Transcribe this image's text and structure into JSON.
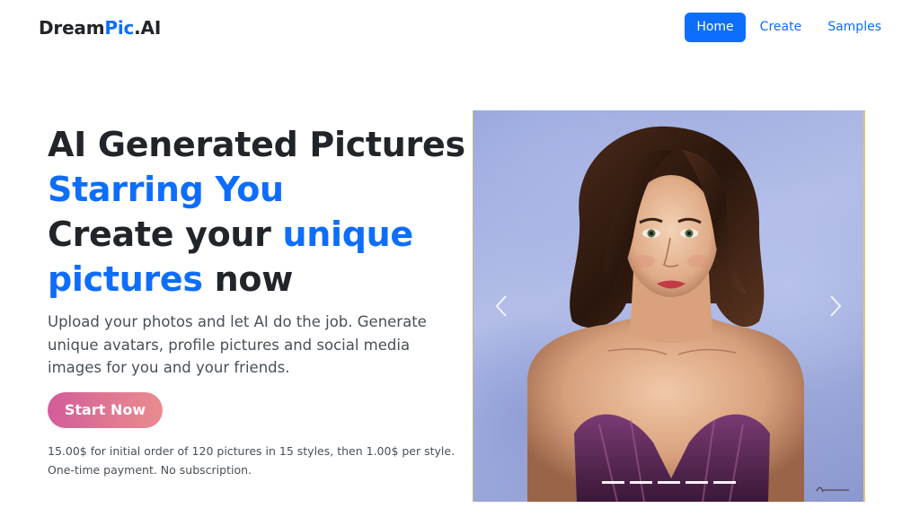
{
  "navbar": {
    "brand_part1": "Dream",
    "brand_part2": "Pic",
    "brand_part3": ".AI",
    "links": [
      {
        "label": "Home",
        "active": true
      },
      {
        "label": "Create",
        "active": false
      },
      {
        "label": "Samples",
        "active": false
      }
    ]
  },
  "hero": {
    "title_line1": "AI Generated Pictures",
    "title_line2": "Starring You",
    "title_line3_a": "Create your ",
    "title_line3_b": "unique",
    "title_line4_a": "pictures",
    "title_line4_b": " now",
    "lead": "Upload your photos and let AI do the job. Generate unique avatars, profile pictures and social media images for you and your friends.",
    "cta_label": "Start Now",
    "price_line1": "15.00$ for initial order of 120 pictures in 15 styles, then 1.00$ per style.",
    "price_line2": "One-time payment. No subscription."
  },
  "carousel": {
    "slide_count": 5,
    "active_slide": 1,
    "prev_icon": "chevron-left-icon",
    "next_icon": "chevron-right-icon"
  },
  "colors": {
    "primary": "#0d6efd",
    "text_dark": "#212529",
    "text_muted": "#495057",
    "cta_gradient_start": "#d35c9b",
    "cta_gradient_end": "#ea8b8f"
  }
}
